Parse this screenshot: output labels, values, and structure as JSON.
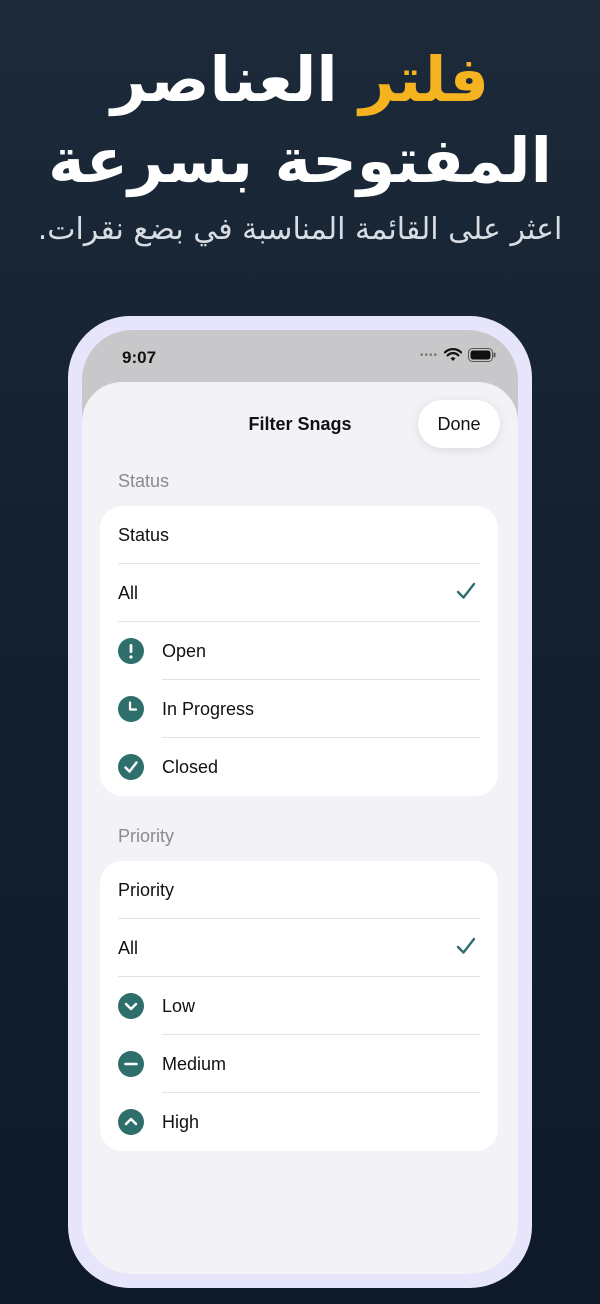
{
  "hero": {
    "line1_accent": "فلتر",
    "line1_rest": "العناصر",
    "line2": "المفتوحة بسرعة",
    "subtitle": "اعثر على القائمة المناسبة في بضع نقرات."
  },
  "status_bar": {
    "time": "9:07",
    "icons": [
      "signal-dots-icon",
      "wifi-icon",
      "battery-icon"
    ]
  },
  "sheet": {
    "title": "Filter Snags",
    "done_label": "Done"
  },
  "status_section": {
    "header": "Status",
    "picker_label": "Status",
    "all_label": "All",
    "all_selected": true,
    "options": [
      {
        "label": "Open",
        "icon": "exclamation-circle-icon"
      },
      {
        "label": "In Progress",
        "icon": "clock-circle-icon"
      },
      {
        "label": "Closed",
        "icon": "checkmark-circle-icon"
      }
    ]
  },
  "priority_section": {
    "header": "Priority",
    "picker_label": "Priority",
    "all_label": "All",
    "all_selected": true,
    "options": [
      {
        "label": "Low",
        "icon": "chevron-down-circle-icon"
      },
      {
        "label": "Medium",
        "icon": "minus-circle-icon"
      },
      {
        "label": "High",
        "icon": "chevron-up-circle-icon"
      }
    ]
  },
  "colors": {
    "accent": "#f5b320",
    "icon_teal": "#2f6f6b",
    "check_teal": "#2f6f6b"
  }
}
